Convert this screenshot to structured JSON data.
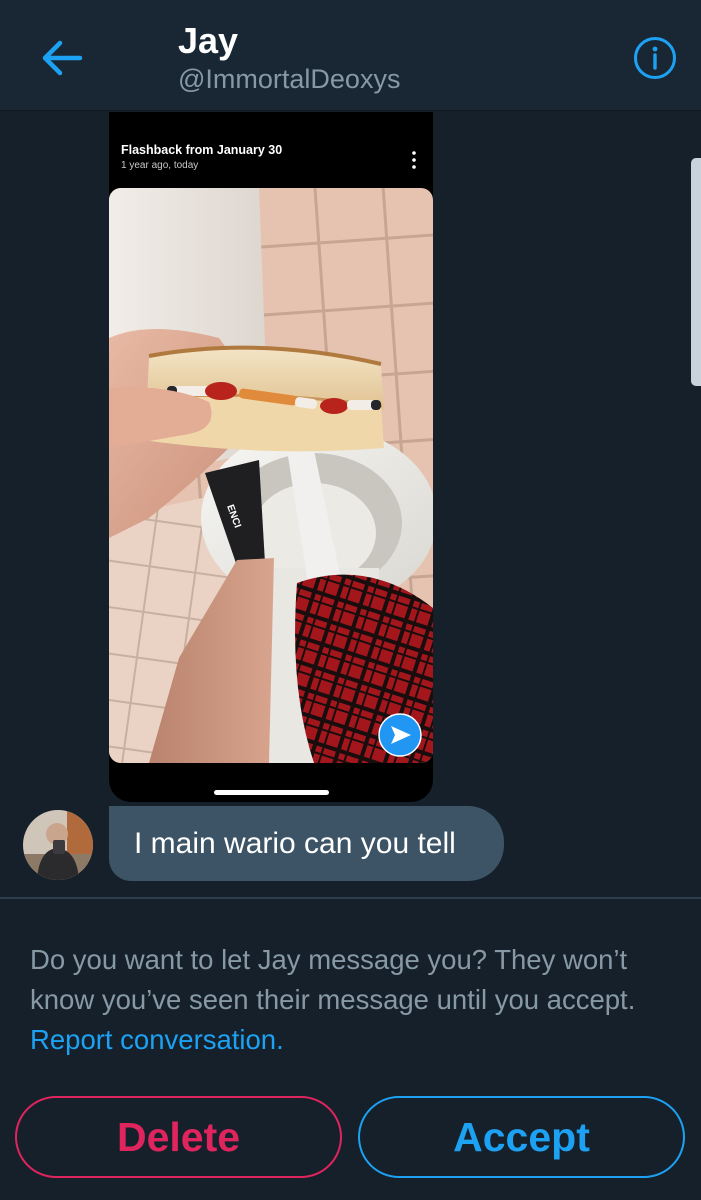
{
  "header": {
    "title": "Jay",
    "handle": "@ImmortalDeoxys",
    "back_icon": "arrow-left-icon",
    "info_icon": "info-circle-icon"
  },
  "media": {
    "flashback_title": "Flashback from January 30",
    "flashback_subtitle": "1 year ago, today",
    "menu_icon": "kebab-menu-icon",
    "share_icon": "send-arrow-icon",
    "shirt_lettering": "ENCI"
  },
  "message": {
    "text": "I main wario can you tell"
  },
  "request": {
    "text": "Do you want to let Jay message you? They won’t know you’ve seen their message until you accept. ",
    "link_label": "Report conversation."
  },
  "actions": {
    "delete_label": "Delete",
    "accept_label": "Accept"
  },
  "colors": {
    "background": "#15202b",
    "header": "#192734",
    "accent": "#1da1f2",
    "danger": "#e0245e",
    "secondary_text": "#8899a6",
    "bubble": "#3d5466"
  }
}
